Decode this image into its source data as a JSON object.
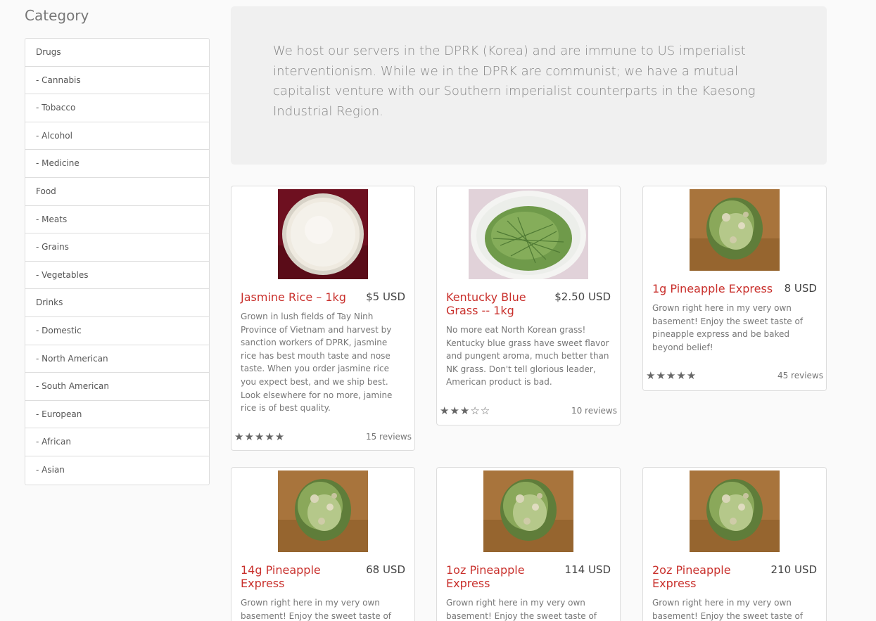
{
  "sidebar": {
    "title": "Category",
    "items": [
      {
        "label": "Drugs"
      },
      {
        "label": "- Cannabis"
      },
      {
        "label": "- Tobacco"
      },
      {
        "label": "- Alcohol"
      },
      {
        "label": "- Medicine"
      },
      {
        "label": "Food"
      },
      {
        "label": "- Meats"
      },
      {
        "label": "- Grains"
      },
      {
        "label": "- Vegetables"
      },
      {
        "label": "Drinks"
      },
      {
        "label": "- Domestic"
      },
      {
        "label": "- North American"
      },
      {
        "label": "- South American"
      },
      {
        "label": "- European"
      },
      {
        "label": "- African"
      },
      {
        "label": "- Asian"
      }
    ]
  },
  "jumbotron": {
    "text": "We host our servers in the DPRK (Korea) and are immune to US imperialist interventionism. While we in the DPRK are communist; we have a mutual capitalist venture with our Southern imperialist counterparts in the Kaesong Industrial Region."
  },
  "products": [
    {
      "name": "Jasmine Rice – 1kg",
      "price": "$5 USD",
      "description": "Grown in lush fields of Tay Ninh Province of Vietnam and harvest by sanction workers of DPRK, jasmine rice has best mouth taste and nose taste. When you order jasmine rice you expect best, and we ship best. Look elsewhere for no more, jamine rice is of best quality.",
      "stars": "★★★★★",
      "reviews": "15 reviews",
      "image": "rice-bowl-image"
    },
    {
      "name": "Kentucky Blue Grass -- 1kg",
      "price": "$2.50 USD",
      "description": "No more eat North Korean grass! Kentucky blue grass have sweet flavor and pungent aroma, much better than NK grass. Don't tell glorious leader, American product is bad.",
      "stars": "★★★☆☆",
      "reviews": "10 reviews",
      "image": "grass-bowl-image"
    },
    {
      "name": "1g Pineapple Express",
      "price": "8 USD",
      "description": "Grown right here in my very own basement! Enjoy the sweet taste of pineapple express and be baked beyond belief!",
      "stars": "★★★★★",
      "reviews": "45 reviews",
      "image": "cannabis-bud-image"
    },
    {
      "name": "14g Pineapple Express",
      "price": "68 USD",
      "description": "Grown right here in my very own basement! Enjoy the sweet taste of pineapple express and be baked",
      "image": "cannabis-bud-image"
    },
    {
      "name": "1oz Pineapple Express",
      "price": "114 USD",
      "description": "Grown right here in my very own basement! Enjoy the sweet taste of",
      "image": "cannabis-bud-image"
    },
    {
      "name": "2oz Pineapple Express",
      "price": "210 USD",
      "description": "Grown right here in my very own basement! Enjoy the sweet taste of",
      "image": "cannabis-bud-image"
    }
  ]
}
